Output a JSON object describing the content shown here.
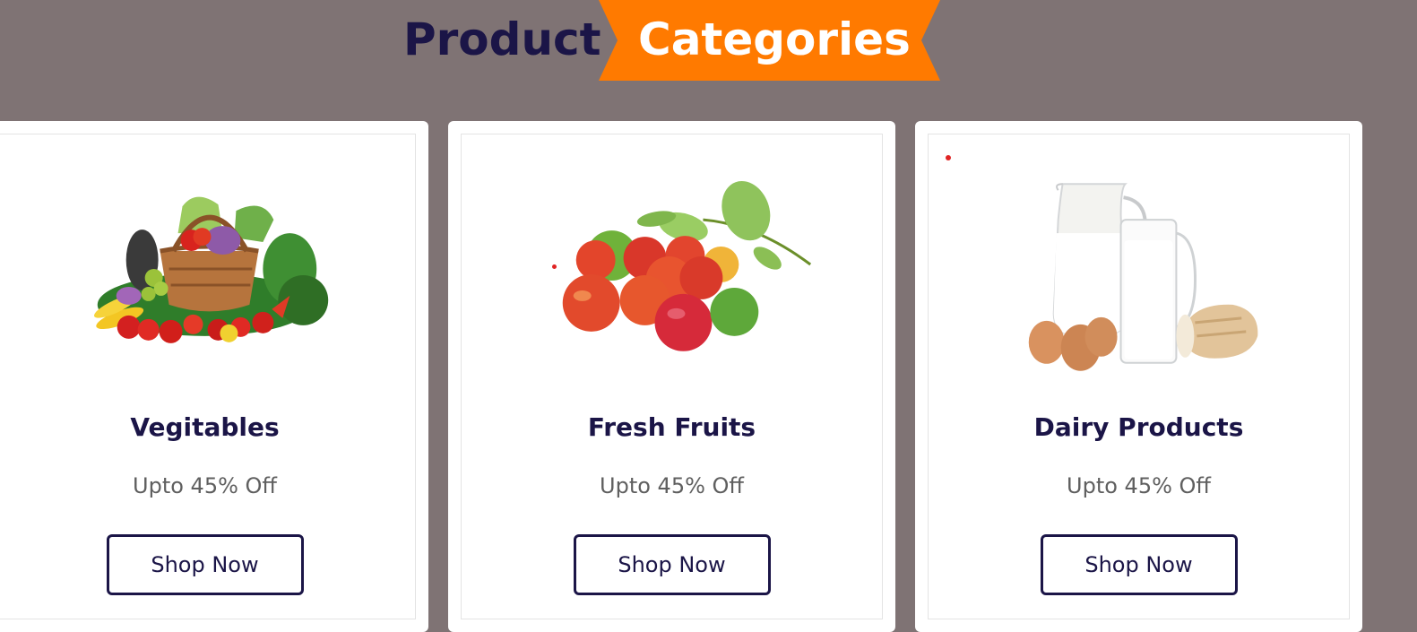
{
  "section": {
    "heading_main": "Product",
    "heading_accent": "Categories",
    "accent_color": "#ff7a00",
    "navy_color": "#1b1547",
    "background_color": "#7f7374"
  },
  "cards": [
    {
      "title": "Vegitables",
      "discount": "Upto 45% Off",
      "button_label": "Shop Now",
      "image_icon": "vegetable-basket-image"
    },
    {
      "title": "Fresh Fruits",
      "discount": "Upto 45% Off",
      "button_label": "Shop Now",
      "image_icon": "fruits-image"
    },
    {
      "title": "Dairy Products",
      "discount": "Upto 45% Off",
      "button_label": "Shop Now",
      "image_icon": "dairy-image"
    }
  ]
}
